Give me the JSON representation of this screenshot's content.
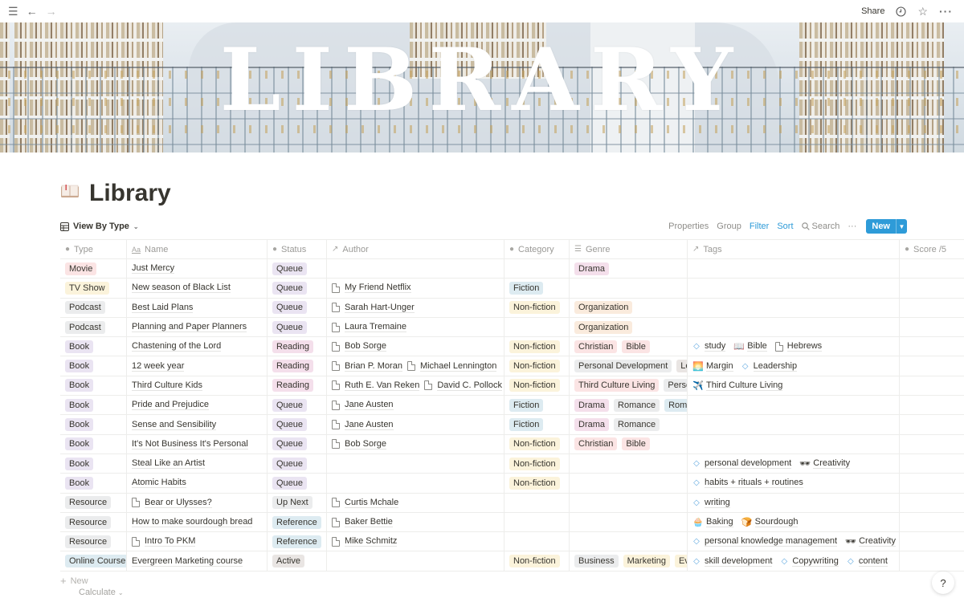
{
  "topbar": {
    "menu_icon": "hamburger-icon",
    "back_icon": "arrow-left-icon",
    "forward_icon": "arrow-right-icon",
    "share_label": "Share",
    "history_icon": "clock-icon",
    "favorite_icon": "star-icon",
    "more_icon": "ellipsis-icon"
  },
  "banner": {
    "title": "LIBRARY"
  },
  "page": {
    "icon": "open-book-icon",
    "title": "Library"
  },
  "view": {
    "name": "View By Type",
    "icon": "table-icon",
    "actions": {
      "properties": "Properties",
      "group": "Group",
      "filter": "Filter",
      "sort": "Sort",
      "search": "Search",
      "more": "···",
      "new": "New"
    }
  },
  "colors": {
    "accent": "#2e9bd8",
    "text": "#37352f",
    "muted": "#9b9a97"
  },
  "table": {
    "columns": [
      {
        "label": "Type",
        "icon": "select-icon"
      },
      {
        "label": "Name",
        "icon": "text-aa-icon"
      },
      {
        "label": "Status",
        "icon": "select-icon"
      },
      {
        "label": "Author",
        "icon": "relation-arrow-icon"
      },
      {
        "label": "Category",
        "icon": "select-icon"
      },
      {
        "label": "Genre",
        "icon": "multiselect-list-icon"
      },
      {
        "label": "Tags",
        "icon": "relation-arrow-icon"
      },
      {
        "label": "Score /5",
        "icon": "select-icon"
      }
    ],
    "rows": [
      {
        "type": {
          "label": "Movie",
          "color": "red"
        },
        "name": "Just Mercy",
        "name_doc": false,
        "status": {
          "label": "Queue",
          "color": "purple"
        },
        "authors": [],
        "category": null,
        "genre": [
          {
            "label": "Drama",
            "color": "pink"
          }
        ],
        "tags": [],
        "score": ""
      },
      {
        "type": {
          "label": "TV Show",
          "color": "yellow"
        },
        "name": "New season of Black List",
        "name_doc": false,
        "status": {
          "label": "Queue",
          "color": "purple"
        },
        "authors": [
          "My Friend Netflix"
        ],
        "category": {
          "label": "Fiction",
          "color": "blue"
        },
        "genre": [],
        "tags": [],
        "score": ""
      },
      {
        "type": {
          "label": "Podcast",
          "color": "gray"
        },
        "name": "Best Laid Plans",
        "name_doc": false,
        "status": {
          "label": "Queue",
          "color": "purple"
        },
        "authors": [
          "Sarah Hart-Unger"
        ],
        "category": {
          "label": "Non-fiction",
          "color": "yellow"
        },
        "genre": [
          {
            "label": "Organization",
            "color": "orange"
          }
        ],
        "tags": [],
        "score": ""
      },
      {
        "type": {
          "label": "Podcast",
          "color": "gray"
        },
        "name": "Planning and Paper Planners",
        "name_doc": false,
        "status": {
          "label": "Queue",
          "color": "purple"
        },
        "authors": [
          "Laura Tremaine"
        ],
        "category": null,
        "genre": [
          {
            "label": "Organization",
            "color": "orange"
          }
        ],
        "tags": [],
        "score": ""
      },
      {
        "type": {
          "label": "Book",
          "color": "purple"
        },
        "name": "Chastening of the Lord",
        "name_doc": false,
        "status": {
          "label": "Reading",
          "color": "pink"
        },
        "authors": [
          "Bob Sorge"
        ],
        "category": {
          "label": "Non-fiction",
          "color": "yellow"
        },
        "genre": [
          {
            "label": "Christian",
            "color": "rose"
          },
          {
            "label": "Bible",
            "color": "rose"
          }
        ],
        "tags": [
          {
            "icon": "diamond",
            "label": "study"
          },
          {
            "icon": "book",
            "label": "Bible"
          },
          {
            "icon": "doc",
            "label": "Hebrews"
          }
        ],
        "score": ""
      },
      {
        "type": {
          "label": "Book",
          "color": "purple"
        },
        "name": "12 week year",
        "name_doc": false,
        "status": {
          "label": "Reading",
          "color": "pink"
        },
        "authors": [
          "Brian P. Moran",
          "Michael Lennington"
        ],
        "category": {
          "label": "Non-fiction",
          "color": "yellow"
        },
        "genre": [
          {
            "label": "Personal Development",
            "color": "gray"
          },
          {
            "label": "Leadership",
            "color": "brown"
          }
        ],
        "tags": [
          {
            "icon": "sunset",
            "label": "Margin"
          },
          {
            "icon": "diamond",
            "label": "Leadership"
          }
        ],
        "score": ""
      },
      {
        "type": {
          "label": "Book",
          "color": "purple"
        },
        "name": "Third Culture Kids",
        "name_doc": false,
        "status": {
          "label": "Reading",
          "color": "pink"
        },
        "authors": [
          "Ruth E. Van Reken",
          "David C. Pollock"
        ],
        "category": {
          "label": "Non-fiction",
          "color": "yellow"
        },
        "genre": [
          {
            "label": "Third Culture Living",
            "color": "rose"
          },
          {
            "label": "Personal",
            "color": "gray"
          }
        ],
        "tags": [
          {
            "icon": "airplane",
            "label": "Third Culture Living"
          }
        ],
        "score": ""
      },
      {
        "type": {
          "label": "Book",
          "color": "purple"
        },
        "name": "Pride and Prejudice",
        "name_doc": false,
        "status": {
          "label": "Queue",
          "color": "purple"
        },
        "authors": [
          "Jane Austen"
        ],
        "category": {
          "label": "Fiction",
          "color": "blue"
        },
        "genre": [
          {
            "label": "Drama",
            "color": "pink"
          },
          {
            "label": "Romance",
            "color": "gray"
          },
          {
            "label": "Rom-Com",
            "color": "blue"
          }
        ],
        "tags": [],
        "score": ""
      },
      {
        "type": {
          "label": "Book",
          "color": "purple"
        },
        "name": "Sense and Sensibility",
        "name_doc": false,
        "status": {
          "label": "Queue",
          "color": "purple"
        },
        "authors": [
          "Jane Austen"
        ],
        "category": {
          "label": "Fiction",
          "color": "blue"
        },
        "genre": [
          {
            "label": "Drama",
            "color": "pink"
          },
          {
            "label": "Romance",
            "color": "gray"
          }
        ],
        "tags": [],
        "score": ""
      },
      {
        "type": {
          "label": "Book",
          "color": "purple"
        },
        "name": "It's Not Business It's Personal",
        "name_doc": false,
        "status": {
          "label": "Queue",
          "color": "purple"
        },
        "authors": [
          "Bob Sorge"
        ],
        "category": {
          "label": "Non-fiction",
          "color": "yellow"
        },
        "genre": [
          {
            "label": "Christian",
            "color": "rose"
          },
          {
            "label": "Bible",
            "color": "rose"
          }
        ],
        "tags": [],
        "score": ""
      },
      {
        "type": {
          "label": "Book",
          "color": "purple"
        },
        "name": "Steal Like an Artist",
        "name_doc": false,
        "status": {
          "label": "Queue",
          "color": "purple"
        },
        "authors": [],
        "category": {
          "label": "Non-fiction",
          "color": "yellow"
        },
        "genre": [],
        "tags": [
          {
            "icon": "diamond",
            "label": "personal development"
          },
          {
            "icon": "sunglasses",
            "label": "Creativity"
          }
        ],
        "score": ""
      },
      {
        "type": {
          "label": "Book",
          "color": "purple"
        },
        "name": "Atomic Habits",
        "name_doc": false,
        "status": {
          "label": "Queue",
          "color": "purple"
        },
        "authors": [],
        "category": {
          "label": "Non-fiction",
          "color": "yellow"
        },
        "genre": [],
        "tags": [
          {
            "icon": "diamond",
            "label": "habits + rituals + routines"
          }
        ],
        "score": ""
      },
      {
        "type": {
          "label": "Resource",
          "color": "gray"
        },
        "name": "Bear or Ulysses?",
        "name_doc": true,
        "status": {
          "label": "Up Next",
          "color": "gray"
        },
        "authors": [
          "Curtis Mchale"
        ],
        "category": null,
        "genre": [],
        "tags": [
          {
            "icon": "diamond",
            "label": "writing"
          }
        ],
        "score": ""
      },
      {
        "type": {
          "label": "Resource",
          "color": "gray"
        },
        "name": "How to make sourdough bread",
        "name_doc": false,
        "status": {
          "label": "Reference",
          "color": "blue"
        },
        "authors": [
          "Baker Bettie"
        ],
        "category": null,
        "genre": [],
        "tags": [
          {
            "icon": "cupcake",
            "label": "Baking"
          },
          {
            "icon": "bread",
            "label": "Sourdough"
          }
        ],
        "score": ""
      },
      {
        "type": {
          "label": "Resource",
          "color": "gray"
        },
        "name": "Intro To PKM",
        "name_doc": true,
        "status": {
          "label": "Reference",
          "color": "blue"
        },
        "authors": [
          "Mike Schmitz"
        ],
        "category": null,
        "genre": [],
        "tags": [
          {
            "icon": "diamond",
            "label": "personal knowledge management"
          },
          {
            "icon": "sunglasses",
            "label": "Creativity"
          }
        ],
        "score": ""
      },
      {
        "type": {
          "label": "Online Course",
          "color": "blue"
        },
        "name": "Evergreen Marketing course",
        "name_doc": false,
        "status": {
          "label": "Active",
          "color": "brown"
        },
        "authors": [],
        "category": {
          "label": "Non-fiction",
          "color": "yellow"
        },
        "genre": [
          {
            "label": "Business",
            "color": "gray"
          },
          {
            "label": "Marketing",
            "color": "yellow"
          },
          {
            "label": "Evergreen",
            "color": "yellow"
          }
        ],
        "tags": [
          {
            "icon": "diamond",
            "label": "skill development"
          },
          {
            "icon": "diamond",
            "label": "Copywriting"
          },
          {
            "icon": "diamond",
            "label": "content"
          }
        ],
        "score": ""
      }
    ],
    "add_row_label": "New",
    "calculate_label": "Calculate"
  },
  "help": {
    "label": "?"
  }
}
